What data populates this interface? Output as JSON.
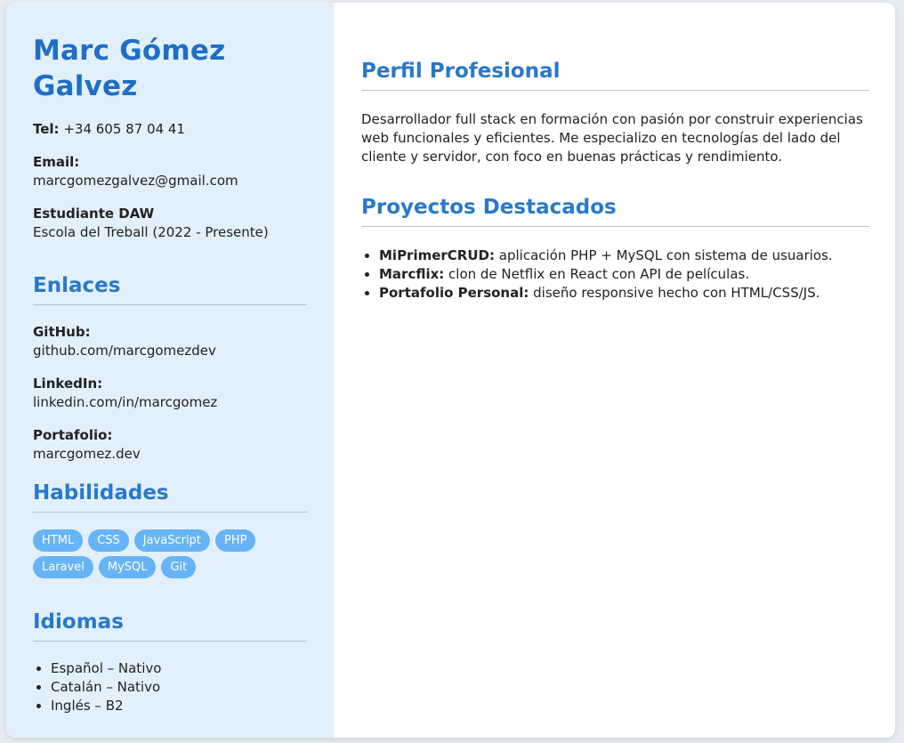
{
  "name": "Marc Gómez Galvez",
  "contact": {
    "tel_label": "Tel:",
    "tel_value": "+34 605 87 04 41",
    "email_label": "Email:",
    "email_value": "marcgomezgalvez@gmail.com",
    "study_label": "Estudiante DAW",
    "study_value": "Escola del Treball (2022 - Presente)"
  },
  "links": {
    "title": "Enlaces",
    "items": [
      {
        "label": "GitHub:",
        "value": "github.com/marcgomezdev"
      },
      {
        "label": "LinkedIn:",
        "value": "linkedin.com/in/marcgomez"
      },
      {
        "label": "Portafolio:",
        "value": "marcgomez.dev"
      }
    ]
  },
  "skills": {
    "title": "Habilidades",
    "items": [
      "HTML",
      "CSS",
      "JavaScript",
      "PHP",
      "Laravel",
      "MySQL",
      "Git"
    ]
  },
  "languages": {
    "title": "Idiomas",
    "items": [
      "Español – Nativo",
      "Catalán – Nativo",
      "Inglés – B2"
    ]
  },
  "profile": {
    "title": "Perfil Profesional",
    "text": "Desarrollador full stack en formación con pasión por construir experiencias web funcionales y eficientes. Me especializo en tecnologías del lado del cliente y servidor, con foco en buenas prácticas y rendimiento."
  },
  "projects": {
    "title": "Proyectos Destacados",
    "items": [
      {
        "name": "MiPrimerCRUD:",
        "desc": " aplicación PHP + MySQL con sistema de usuarios."
      },
      {
        "name": "Marcflix:",
        "desc": " clon de Netflix en React con API de películas."
      },
      {
        "name": "Portafolio Personal:",
        "desc": " diseño responsive hecho con HTML/CSS/JS."
      }
    ]
  },
  "colors": {
    "accent": "#2979c9",
    "sidebar_bg": "#e2f0fc",
    "chip_bg": "#66b4f5"
  }
}
